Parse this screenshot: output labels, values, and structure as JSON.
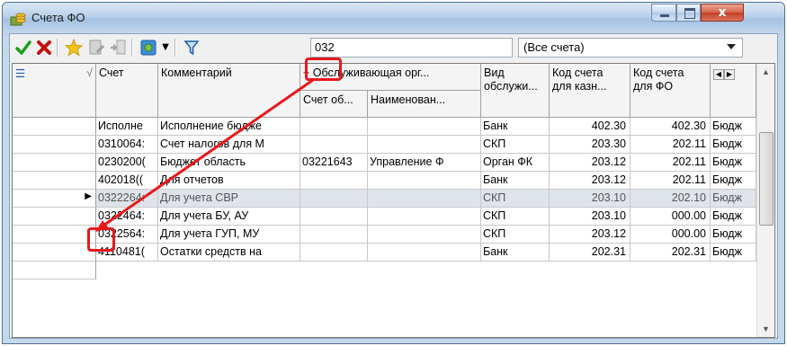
{
  "window": {
    "title": "Счета ФО",
    "close_glyph": "x"
  },
  "toolbar": {
    "icons": [
      "check-icon",
      "cancel-icon",
      "star-icon",
      "doc-edit-icon",
      "doc-move-icon",
      "settings-icon",
      "filter-icon"
    ],
    "search_value": "032",
    "filter_combo_value": "(Все счета)"
  },
  "grid": {
    "headers": {
      "schet": "Счет",
      "comment": "Комментарий",
      "serv_org": "Обслуживающая орг...",
      "serv_org_acc": "Счет об...",
      "serv_org_name": "Наименован...",
      "vid1": "Вид",
      "vid2": "обслужи...",
      "kod_kazn1": "Код счета",
      "kod_kazn2": "для казн...",
      "kod_fo1": "Код счета",
      "kod_fo2": "для ФО"
    },
    "rows": [
      {
        "schet": "Исполне",
        "comment": "Исполнение бюдже",
        "acc": "",
        "name": "",
        "vid": "Банк",
        "kazn": "402.30",
        "fo": "402.30",
        "last": "Бюдж"
      },
      {
        "schet": "0310064:",
        "comment": "Счет налогов для М",
        "acc": "",
        "name": "",
        "vid": "СКП",
        "kazn": "203.30",
        "fo": "202.11",
        "last": "Бюдж"
      },
      {
        "schet": "0230200(",
        "comment": "Бюджет область",
        "acc": "03221643",
        "name": "Управление Ф",
        "vid": "Орган ФК",
        "kazn": "203.12",
        "fo": "202.11",
        "last": "Бюдж"
      },
      {
        "schet": "402018((",
        "comment": "Для отчетов",
        "acc": "",
        "name": "",
        "vid": "Банк",
        "kazn": "203.12",
        "fo": "202.11",
        "last": "Бюдж"
      },
      {
        "schet": "0322264:",
        "comment": "Для учета СВР",
        "acc": "",
        "name": "",
        "vid": "СКП",
        "kazn": "203.10",
        "fo": "202.10",
        "last": "Бюдж"
      },
      {
        "schet": "0322464:",
        "comment": "Для учета БУ, АУ",
        "acc": "",
        "name": "",
        "vid": "СКП",
        "kazn": "203.10",
        "fo": "000.00",
        "last": "Бюдж"
      },
      {
        "schet": "0322564:",
        "comment": "Для учета ГУП, МУ",
        "acc": "",
        "name": "",
        "vid": "СКП",
        "kazn": "203.12",
        "fo": "000.00",
        "last": "Бюдж"
      },
      {
        "schet": "4110481(",
        "comment": "Остатки средств на",
        "acc": "",
        "name": "",
        "vid": "Банк",
        "kazn": "202.31",
        "fo": "202.31",
        "last": "Бюдж"
      }
    ],
    "selected_row_index": 4
  }
}
